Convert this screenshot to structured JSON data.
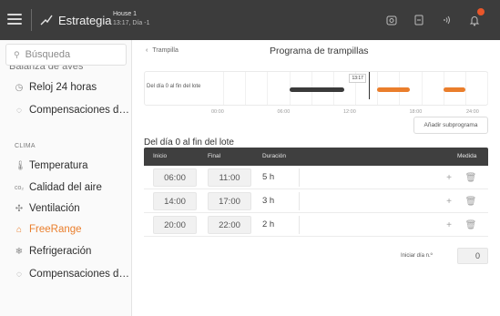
{
  "topbar": {
    "brand": "Estrategia",
    "house_line1": "House 1",
    "house_line2": "13:17, Día -1",
    "icons": [
      "menu-icon",
      "trend-icon",
      "camera-icon",
      "device-icon",
      "signal-icon",
      "bell-icon"
    ]
  },
  "sidebar": {
    "search_placeholder": "Búsqueda",
    "cut_item": "Balanza de aves",
    "items_top": [
      {
        "label": "Reloj 24 horas",
        "icon": "clock-icon"
      },
      {
        "label": "Compensaciones del u...",
        "icon": "compensation-icon"
      }
    ],
    "section": "CLIMA",
    "items_clima": [
      {
        "label": "Temperatura",
        "icon": "thermometer-icon"
      },
      {
        "label": "Calidad del aire",
        "icon": "co2-icon"
      },
      {
        "label": "Ventilación",
        "icon": "fan-icon"
      },
      {
        "label": "FreeRange",
        "icon": "freerange-icon",
        "active": true
      },
      {
        "label": "Refrigeración",
        "icon": "cooling-icon"
      },
      {
        "label": "Compensaciones del u...",
        "icon": "compensation-icon"
      }
    ]
  },
  "main": {
    "back_label": "Trampilla",
    "title": "Programa de trampillas",
    "timeline": {
      "row_label": "Del día 0 al fin del lote",
      "now_label": "13:17",
      "ticks": [
        "00:00",
        "06:00",
        "12:00",
        "18:00",
        "24:00"
      ]
    },
    "add_button": "Añadir subprograma",
    "section_title": "Del día 0 al fin del lote",
    "table": {
      "headers": {
        "start": "Inicio",
        "end": "Final",
        "duration": "Duración",
        "action": "Medida"
      },
      "rows": [
        {
          "start": "06:00",
          "end": "11:00",
          "duration": "5 h"
        },
        {
          "start": "14:00",
          "end": "17:00",
          "duration": "3 h"
        },
        {
          "start": "20:00",
          "end": "22:00",
          "duration": "2 h"
        }
      ]
    },
    "start_day_label": "Iniciar día n.º",
    "start_day_value": "0"
  },
  "colors": {
    "accent": "#ea7e2c",
    "topbar": "#3c3c3c",
    "table_header": "#3f3f3f",
    "bar_dark": "#3a3a3a"
  },
  "chart_data": {
    "type": "timeline",
    "x_range_hours": [
      0,
      24
    ],
    "now_hour": 13.28,
    "segments": [
      {
        "start": 6,
        "end": 11,
        "status": "past"
      },
      {
        "start": 14,
        "end": 17,
        "status": "upcoming"
      },
      {
        "start": 20,
        "end": 22,
        "status": "upcoming"
      }
    ]
  }
}
